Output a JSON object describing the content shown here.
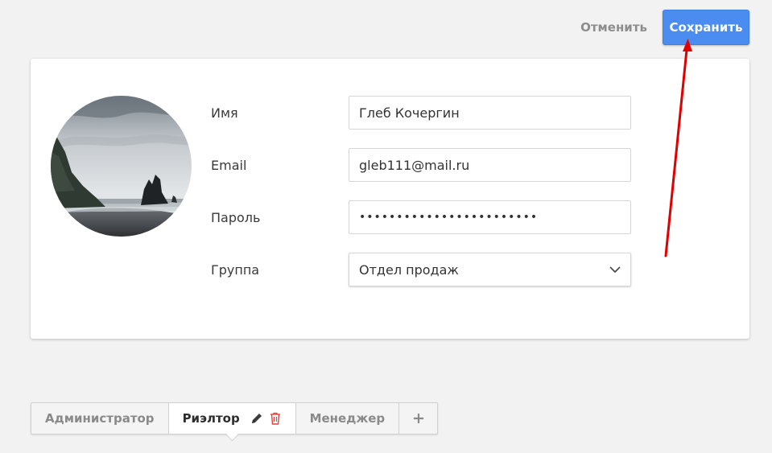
{
  "actions": {
    "cancel_label": "Отменить",
    "save_label": "Сохранить"
  },
  "form": {
    "name": {
      "label": "Имя",
      "value": "Глеб Кочергин"
    },
    "email": {
      "label": "Email",
      "value": "gleb111@mail.ru"
    },
    "password": {
      "label": "Пароль",
      "value": "••••••••••••••••••••••••"
    },
    "group": {
      "label": "Группа",
      "value": "Отдел продаж"
    }
  },
  "tabs": [
    {
      "label": "Администратор"
    },
    {
      "label": "Риэлтор",
      "active": true
    },
    {
      "label": "Менеджер"
    }
  ],
  "icons": {
    "edit": "pencil-icon",
    "delete": "trash-icon",
    "add": "plus-icon",
    "dropdown": "chevron-down-icon"
  },
  "colors": {
    "accent": "#4a8cf0",
    "delete": "#e0413b",
    "annotation": "#e00000"
  }
}
